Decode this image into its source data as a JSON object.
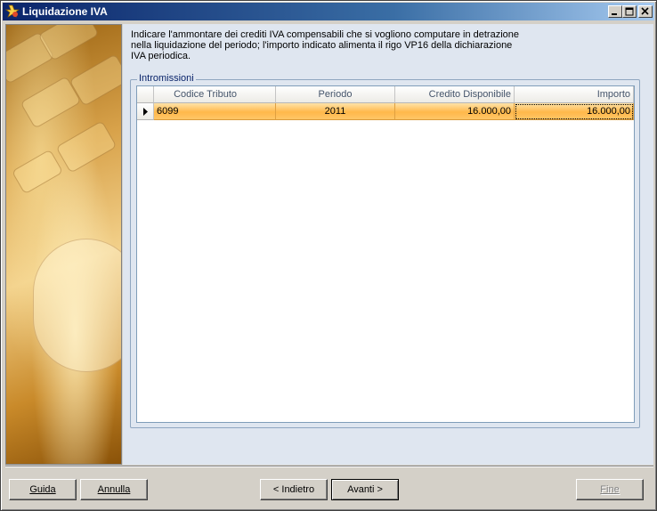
{
  "window": {
    "title": "Liquidazione IVA"
  },
  "intro_text": "Indicare l'ammontare dei crediti IVA compensabili che si vogliono computare in detrazione nella liquidazione del periodo; l'importo indicato alimenta il rigo VP16 della dichiarazione IVA periodica.",
  "group": {
    "label": "Intromissioni"
  },
  "table": {
    "columns": [
      "Codice Tributo",
      "Periodo",
      "Credito Disponibile",
      "Importo"
    ],
    "rows": [
      {
        "codice": "6099",
        "periodo": "2011",
        "credito": "16.000,00",
        "importo": "16.000,00"
      }
    ]
  },
  "buttons": {
    "guida": "Guida",
    "annulla": "Annulla",
    "indietro": "< Indietro",
    "avanti": "Avanti >",
    "fine": "Fine"
  },
  "colors": {
    "title_bar": "#0a246a",
    "row_highlight": "#ffb84a",
    "panel_background": "#dfe6f0"
  },
  "icons": {
    "app": "app-icon",
    "minimize": "minimize-icon",
    "maximize": "maximize-icon",
    "close": "close-icon",
    "row_selector": "row-pointer-icon"
  }
}
